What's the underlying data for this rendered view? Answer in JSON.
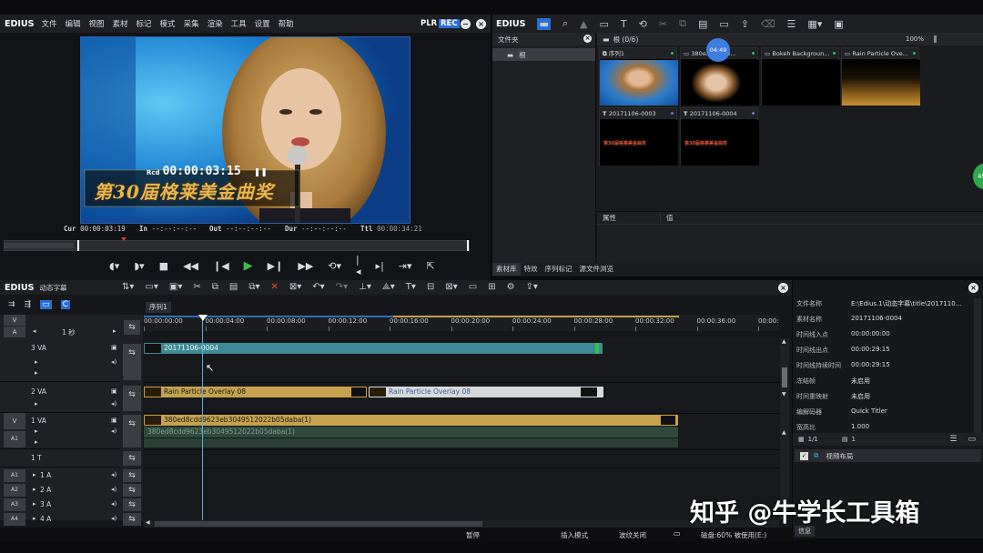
{
  "player": {
    "brand": "EDIUS",
    "menu": [
      "文件",
      "编辑",
      "视图",
      "素材",
      "标记",
      "模式",
      "采集",
      "渲染",
      "工具",
      "设置",
      "帮助"
    ],
    "plr": "PLR",
    "rec": "REC",
    "rcd_label": "Rcd",
    "rcd_time": "00:00:03:15",
    "overlay_text": "第30届格莱美金曲奖",
    "cur_label": "Cur",
    "cur_time": "00:00:03:19",
    "in_label": "In",
    "in_time": "--:--:--:--",
    "out_label": "Out",
    "out_time": "--:--:--:--",
    "dur_label": "Dur",
    "dur_time": "--:--:--:--",
    "ttl_label": "Ttl",
    "ttl_time": "00:00:34:21"
  },
  "bin": {
    "brand": "EDIUS",
    "folder_title": "文件夹",
    "folder_root": "根",
    "path": "根 (0/6)",
    "zoom": "100%",
    "badge_time": "04:49",
    "side_badge": "49",
    "clips": [
      {
        "name": "序列1",
        "type": "seq",
        "thumb": "face"
      },
      {
        "name": "380e...9623e...",
        "type": "video",
        "thumb": "face2"
      },
      {
        "name": "Bokeh Backgroun...",
        "type": "video",
        "thumb": "black"
      },
      {
        "name": "Rain Particle Ove...",
        "type": "video",
        "thumb": "gold"
      },
      {
        "name": "20171106-0003",
        "type": "title",
        "thumb": "title",
        "caption": "第30届格莱美金曲奖"
      },
      {
        "name": "20171106-0004",
        "type": "title",
        "thumb": "title",
        "caption": "第30届格莱美金曲奖"
      }
    ],
    "props_col1": "属性",
    "props_col2": "值",
    "tabs": [
      "素材库",
      "特效",
      "序列标记",
      "源文件浏览"
    ]
  },
  "timeline": {
    "brand": "EDIUS",
    "project": "动态字幕",
    "seq_tab": "序列1",
    "scale": "1 秒",
    "ruler": [
      "00:00:00:00",
      "00:00:04:00",
      "00:00:08:00",
      "00:00:12:00",
      "00:00:16:00",
      "00:00:20:00",
      "00:00:24:00",
      "00:00:28:00",
      "00:00:32:00",
      "00:00:36:00",
      "00:00:"
    ],
    "tracks": [
      "3 VA",
      "2 VA",
      "1 VA",
      "1 T",
      "1 A",
      "2 A",
      "3 A",
      "4 A"
    ],
    "clip_3va": "20171106-0004",
    "clip_2va_a": "Rain Particle Overlay 08",
    "clip_2va_b": "Rain Particle Overlay 08",
    "clip_1va_v": "380ed8cdd9623eb3049512022b05daba(1)",
    "clip_1va_a": "380ed8cdd9623eb3049512022b05daba(1)"
  },
  "info": {
    "rows": [
      {
        "k": "文件名称",
        "v": "E:\\Edius.1\\动态字幕\\title\\2017110..."
      },
      {
        "k": "素材名称",
        "v": "20171106-0004"
      },
      {
        "k": "时间线入点",
        "v": "00:00:00:00"
      },
      {
        "k": "时间线出点",
        "v": "00:00:29:15"
      },
      {
        "k": "时间线持续时间",
        "v": "00:00:29:15"
      },
      {
        "k": "冻结帧",
        "v": "未启用"
      },
      {
        "k": "时间重映射",
        "v": "未启用"
      },
      {
        "k": "编解码器",
        "v": "Quick Titler"
      },
      {
        "k": "宽高比",
        "v": "1.000"
      }
    ],
    "page": "1/1",
    "count": "1",
    "effect": "视频布局",
    "tab": "信息"
  },
  "status": {
    "state": "暂停",
    "mode": "插入模式",
    "ripple": "波纹关闭",
    "disk": "磁盘:60% 被使用(E:)"
  },
  "watermark": "知乎 @牛学长工具箱"
}
